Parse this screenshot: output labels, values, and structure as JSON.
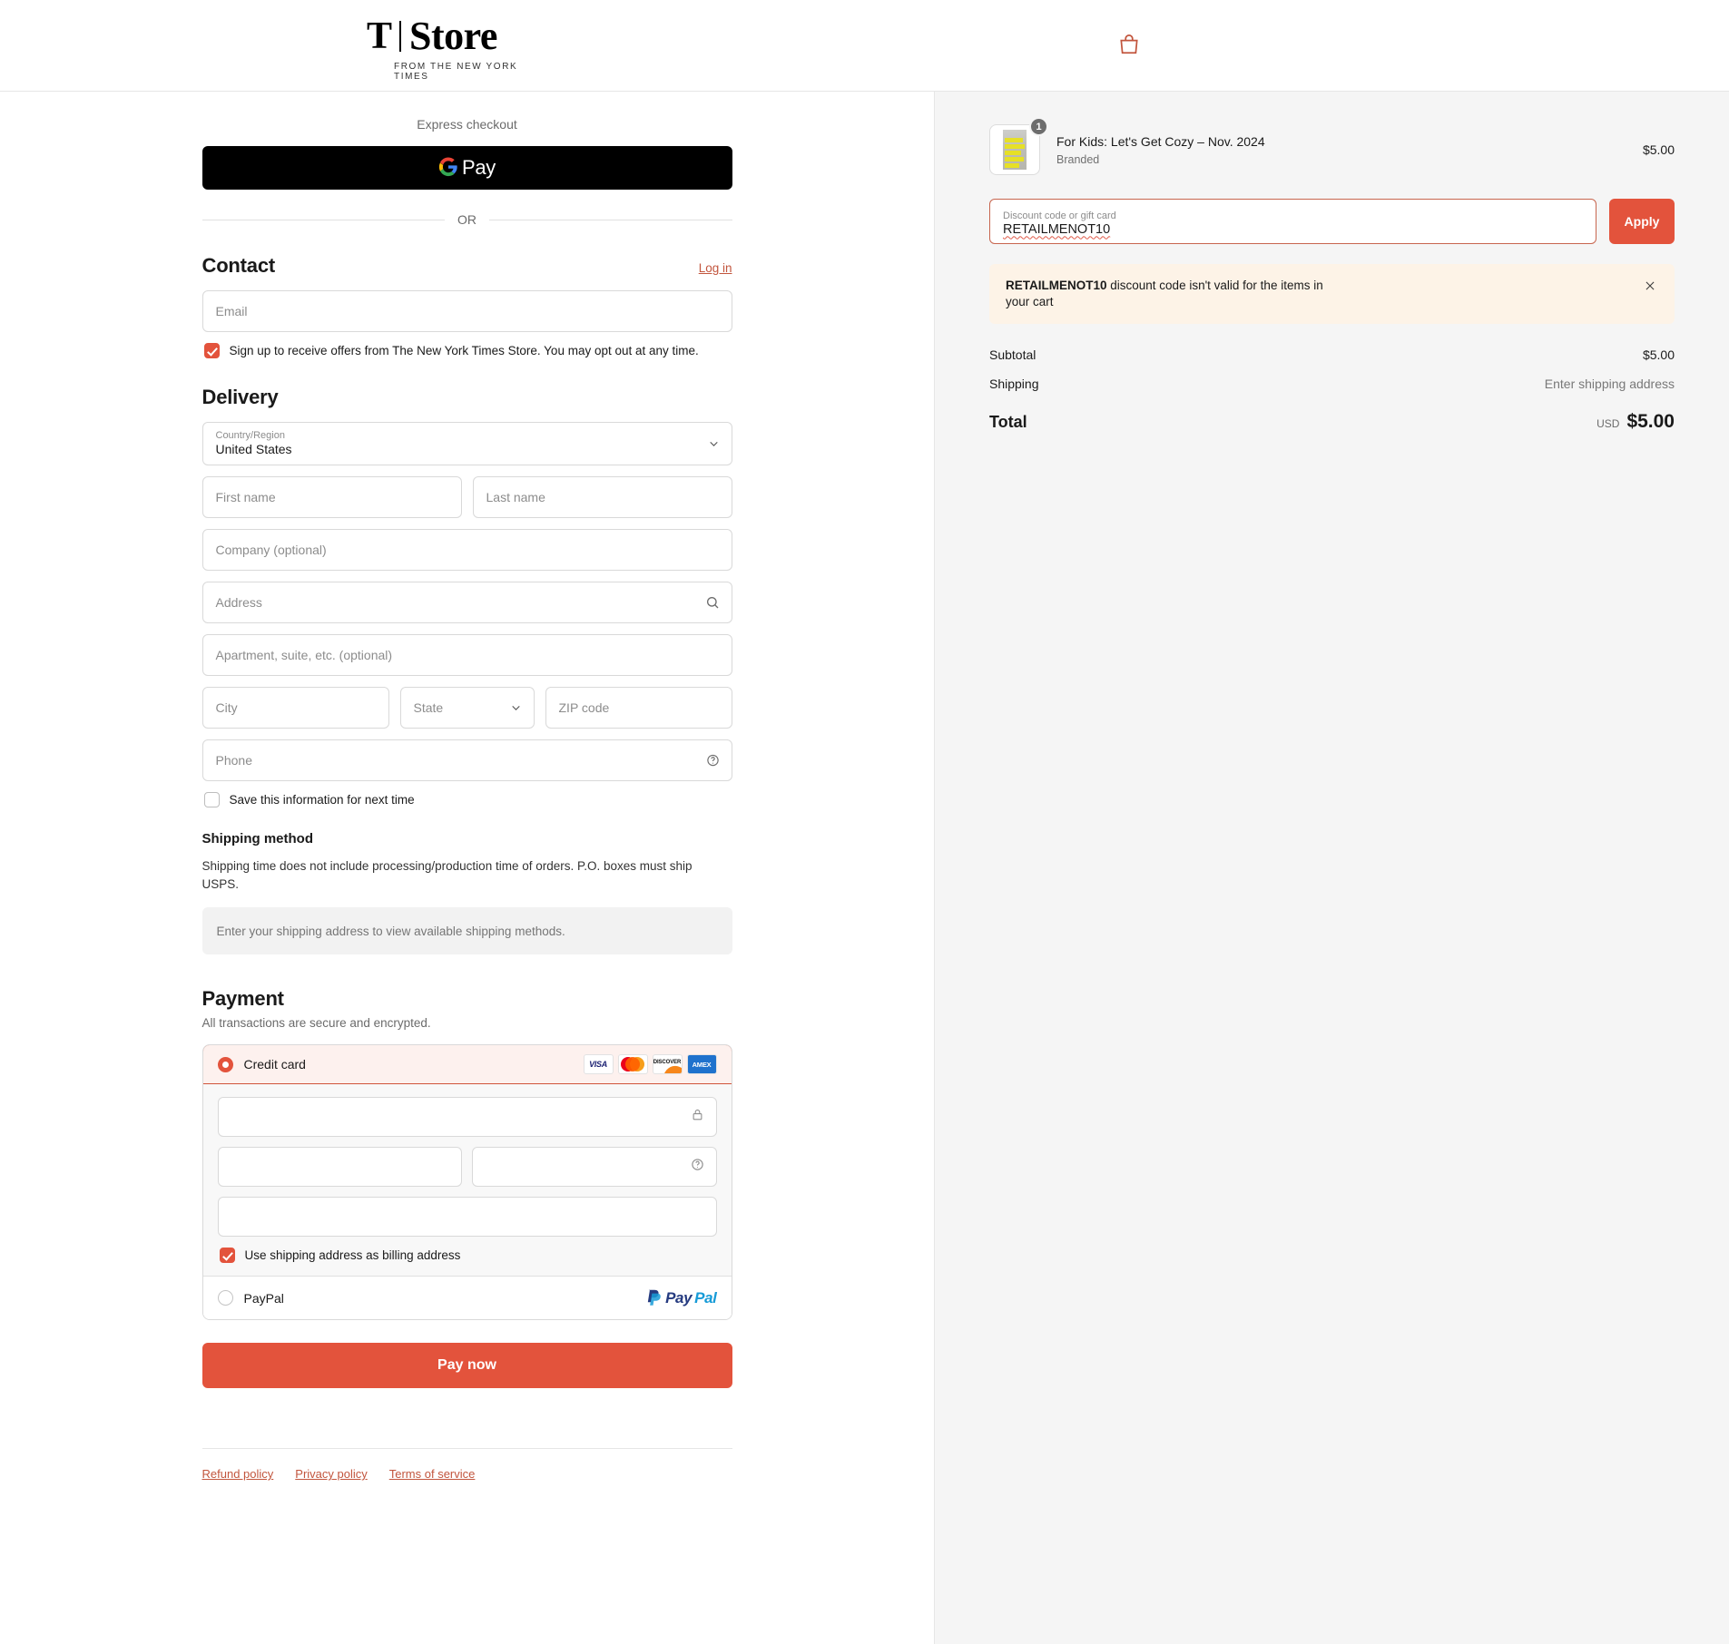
{
  "header": {
    "logo_mark": "T",
    "logo_name": "Store",
    "logo_tagline": "FROM THE NEW YORK TIMES",
    "cart_icon": "shopping-bag-icon"
  },
  "express": {
    "label": "Express checkout",
    "gpay_label": "Pay",
    "gpay_icon": "google-g-icon",
    "or_label": "OR"
  },
  "contact": {
    "title": "Contact",
    "login_label": "Log in",
    "email_placeholder": "Email",
    "email_value": "",
    "newsletter_label": "Sign up to receive offers from The New York Times Store. You may opt out at any time.",
    "newsletter_checked": true
  },
  "delivery": {
    "title": "Delivery",
    "country_label": "Country/Region",
    "country_value": "United States",
    "first_name_placeholder": "First name",
    "first_name_value": "",
    "last_name_placeholder": "Last name",
    "last_name_value": "",
    "company_placeholder": "Company (optional)",
    "company_value": "",
    "address_placeholder": "Address",
    "address_value": "",
    "address_icon": "search-icon",
    "apartment_placeholder": "Apartment, suite, etc. (optional)",
    "apartment_value": "",
    "city_placeholder": "City",
    "city_value": "",
    "state_placeholder": "State",
    "state_value": "",
    "zip_placeholder": "ZIP code",
    "zip_value": "",
    "phone_placeholder": "Phone",
    "phone_value": "",
    "phone_icon": "help-circle-icon",
    "save_info_label": "Save this information for next time",
    "save_info_checked": false
  },
  "shipping": {
    "title": "Shipping method",
    "note": "Shipping time does not include processing/production time of orders. P.O. boxes must ship USPS.",
    "empty_message": "Enter your shipping address to view available shipping methods."
  },
  "payment": {
    "title": "Payment",
    "subtitle": "All transactions are secure and encrypted.",
    "credit_card_label": "Credit card",
    "credit_card_selected": true,
    "brands": [
      "VISA",
      "Mastercard",
      "DISCOVER",
      "AMEX"
    ],
    "card_number_value": "",
    "card_number_icon": "lock-icon",
    "expiry_value": "",
    "cvv_value": "",
    "cvv_icon": "help-circle-icon",
    "name_on_card_value": "",
    "billing_same_label": "Use shipping address as billing address",
    "billing_same_checked": true,
    "paypal_label": "PayPal",
    "paypal_selected": false,
    "paypal_logo_first": "Pay",
    "paypal_logo_second": "Pal",
    "pay_now_label": "Pay now"
  },
  "footer": {
    "links": [
      "Refund policy",
      "Privacy policy",
      "Terms of service"
    ]
  },
  "order_summary": {
    "item": {
      "title": "For Kids: Let's Get Cozy – Nov. 2024",
      "variant": "Branded",
      "price": "$5.00",
      "quantity": "1"
    },
    "discount_label": "Discount code or gift card",
    "discount_value": "RETAILMENOT10",
    "apply_label": "Apply",
    "alert_code": "RETAILMENOT10",
    "alert_message": " discount code isn't valid for the items in your cart",
    "alert_close_icon": "close-icon",
    "subtotal_label": "Subtotal",
    "subtotal_value": "$5.00",
    "shipping_label": "Shipping",
    "shipping_value": "Enter shipping address",
    "total_label": "Total",
    "total_currency": "USD",
    "total_value": "$5.00"
  },
  "colors": {
    "accent": "#e3533c",
    "link": "#c2553d",
    "alert_bg": "#fdf3e7",
    "panel_bg": "#f5f5f5"
  }
}
